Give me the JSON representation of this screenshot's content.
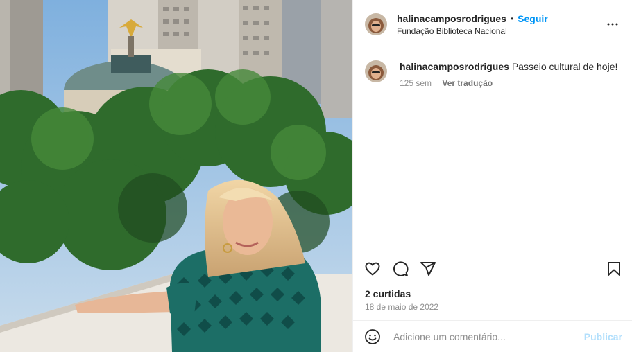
{
  "post": {
    "username": "halinacamposrodrigues",
    "separator": "•",
    "follow_label": "Seguir",
    "location": "Fundação Biblioteca Nacional",
    "caption_text": "Passeio cultural de hoje!",
    "caption_age": "125 sem",
    "translate_label": "Ver tradução",
    "likes_text": "2 curtidas",
    "date_text": "18 de maio de 2022"
  },
  "comment_box": {
    "placeholder": "Adicione um comentário...",
    "publish_label": "Publicar"
  },
  "icons": {
    "more": "more-options-icon",
    "like": "heart-icon",
    "comment": "comment-icon",
    "share": "share-icon",
    "save": "bookmark-icon",
    "emoji": "emoji-icon"
  },
  "colors": {
    "accent": "#0095f6",
    "publish_disabled": "#b2dffc",
    "muted": "#8e8e8e",
    "border": "#efefef"
  }
}
